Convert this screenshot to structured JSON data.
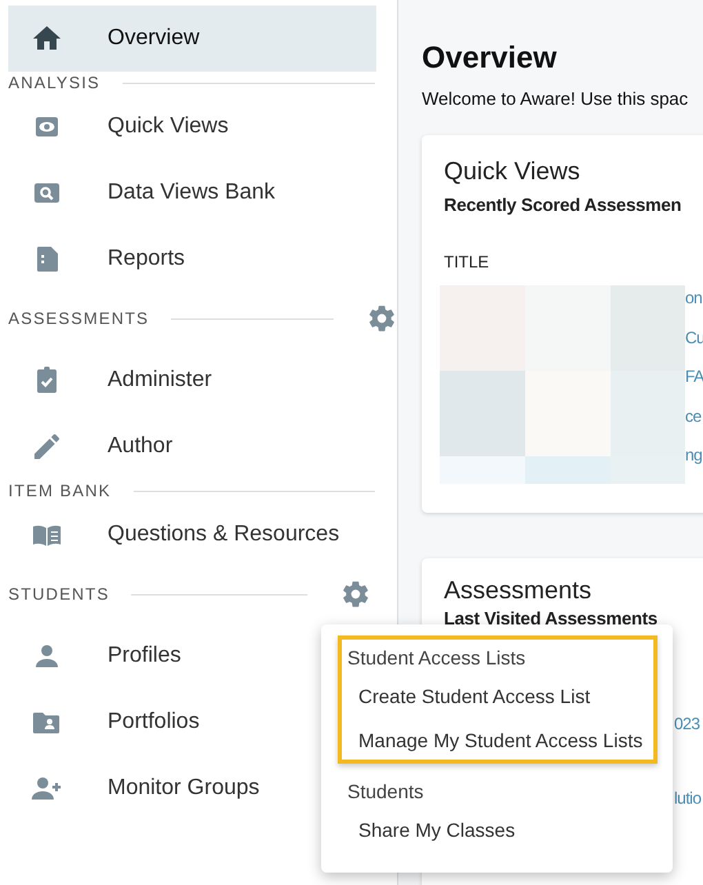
{
  "sidebar": {
    "sections": [
      {
        "items": [
          {
            "label": "Overview",
            "selected": true
          }
        ]
      },
      {
        "heading": "ANALYSIS",
        "settings": false,
        "items": [
          {
            "label": "Quick Views",
            "selected": false
          },
          {
            "label": "Data Views Bank",
            "selected": false
          },
          {
            "label": "Reports",
            "selected": false
          }
        ]
      },
      {
        "heading": "ASSESSMENTS",
        "settings": true,
        "items": [
          {
            "label": "Administer",
            "selected": false
          },
          {
            "label": "Author",
            "selected": false
          }
        ]
      },
      {
        "heading": "ITEM BANK",
        "settings": false,
        "items": [
          {
            "label": "Questions & Resources",
            "selected": false
          }
        ]
      },
      {
        "heading": "STUDENTS",
        "settings": true,
        "items": [
          {
            "label": "Profiles",
            "selected": false
          },
          {
            "label": "Portfolios",
            "selected": false
          },
          {
            "label": "Monitor Groups",
            "selected": false
          }
        ]
      }
    ]
  },
  "main": {
    "title": "Overview",
    "intro": "Welcome to Aware! Use this spac",
    "cards": [
      {
        "title": "Quick Views",
        "subtitle": "Recently Scored Assessmen",
        "column": "TITLE",
        "links": [
          "on",
          "Cu",
          "FA",
          "ce",
          "ng"
        ]
      },
      {
        "title": "Assessments",
        "subtitle": "Last Visited Assessments",
        "links": [
          "023",
          "lutio"
        ]
      }
    ]
  },
  "menu": {
    "groups": [
      {
        "heading": "Student Access Lists",
        "highlighted": true,
        "items": [
          "Create Student Access List",
          "Manage My Student Access Lists"
        ]
      },
      {
        "heading": "Students",
        "highlighted": false,
        "items": [
          "Share My Classes"
        ]
      }
    ]
  }
}
